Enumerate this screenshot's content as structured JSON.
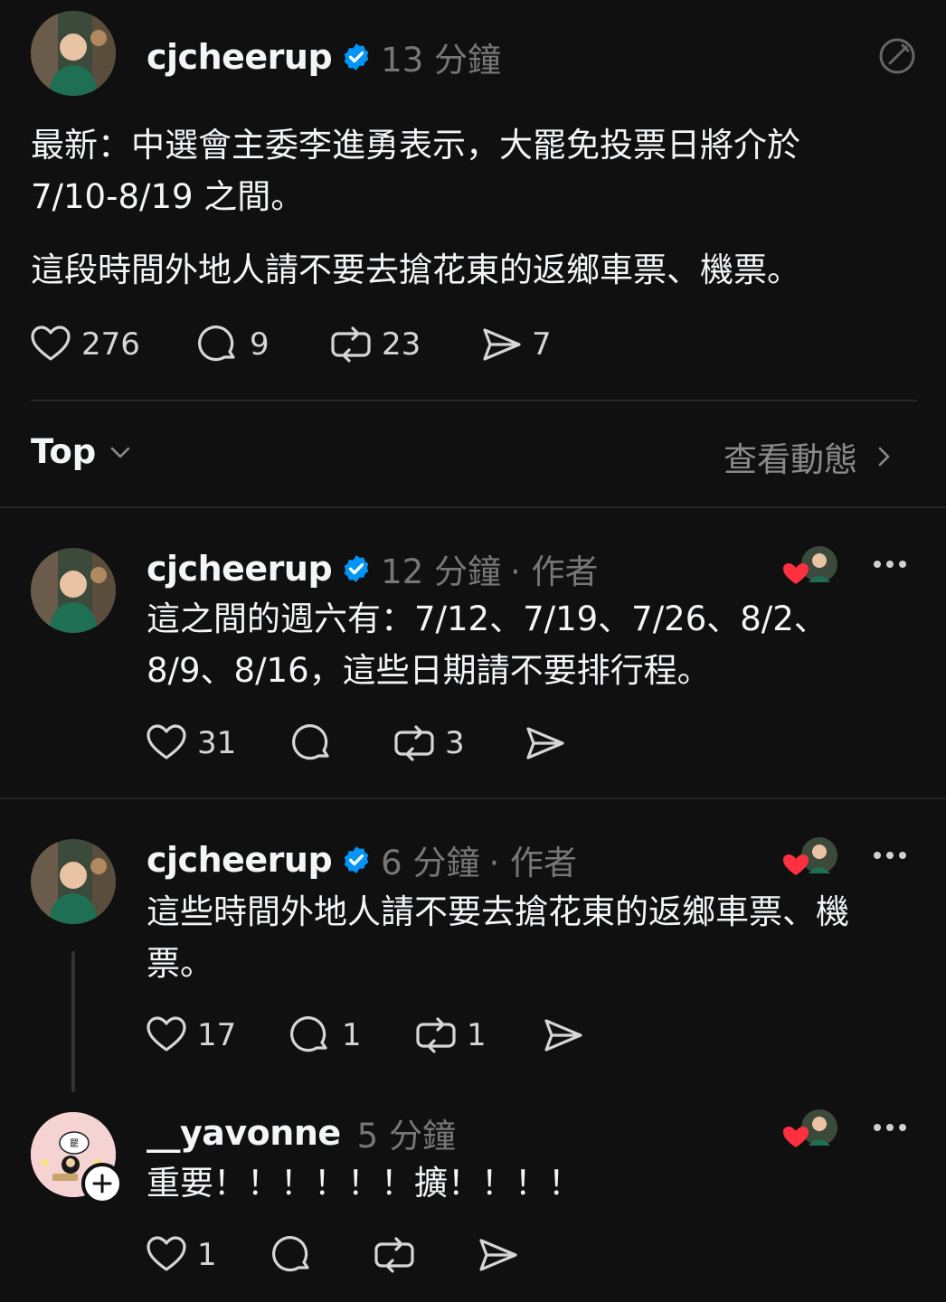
{
  "main_post": {
    "username": "cjcheerup",
    "time": "13 分鐘",
    "text_line1": "最新：中選會主委李進勇表示，大罷免投票日將介於",
    "text_line2": "7/10-8/19 之間。",
    "text_line3": "這段時間外地人請不要去搶花東的返鄉車票、機票。",
    "likes": "276",
    "replies": "9",
    "reposts": "23",
    "shares": "7"
  },
  "sort_bar": {
    "label": "Top",
    "activity": "查看動態"
  },
  "replies": [
    {
      "username": "cjcheerup",
      "time": "12 分鐘",
      "author_tag": "· 作者",
      "line1": "這之間的週六有：7/12、7/19、7/26、8/2、",
      "line2": "8/9、8/16，這些日期請不要排行程。",
      "likes": "31",
      "reposts": "3"
    },
    {
      "username": "cjcheerup",
      "time": "6 分鐘",
      "author_tag": "· 作者",
      "line1": "這些時間外地人請不要去搶花東的返鄉車票、機",
      "line2": "票。",
      "likes": "17",
      "replies": "1",
      "reposts": "1"
    },
    {
      "username": "__yavonne",
      "time": "5 分鐘",
      "line1": "重要！！！！！！擴！！！！",
      "likes": "1"
    }
  ],
  "colors": {
    "background": "#101010",
    "verified": "#0095f6",
    "secondary_text": "#777777",
    "heart": "#ff3040"
  }
}
